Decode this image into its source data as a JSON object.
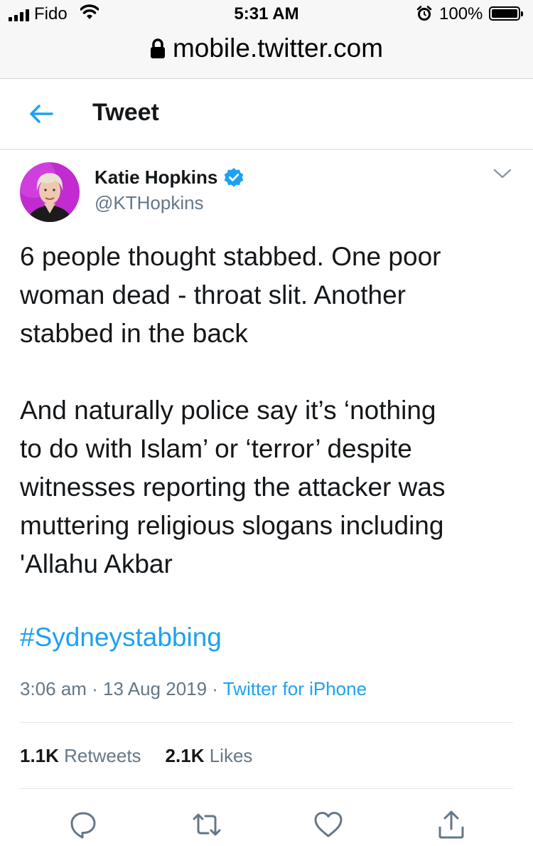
{
  "status_bar": {
    "carrier": "Fido",
    "time": "5:31 AM",
    "battery_percent": "100%",
    "battery_level": 1.0,
    "icons": [
      "signal-icon",
      "wifi-icon",
      "alarm-icon",
      "battery-icon"
    ]
  },
  "browser": {
    "url": "mobile.twitter.com",
    "lock_icon": "lock-icon"
  },
  "header": {
    "back_icon": "back-arrow-icon",
    "title": "Tweet"
  },
  "tweet": {
    "author_name": "Katie Hopkins",
    "verified_icon": "verified-badge-icon",
    "handle": "@KTHopkins",
    "menu_icon": "chevron-down-icon",
    "text_lines_1": [
      "6 people thought stabbed. One poor",
      "woman dead - throat slit. Another",
      "stabbed in the back"
    ],
    "text_lines_2": [
      "And naturally police say it’s ‘nothing",
      "to do with Islam’ or ‘terror’ despite",
      "witnesses reporting the attacker was",
      "muttering religious slogans including",
      "'Allahu Akbar"
    ],
    "hashtag": "#Sydneystabbing",
    "timestamp": "3:06 am · 13 Aug 2019 · ",
    "source": "Twitter for iPhone",
    "retweets_count": "1.1K",
    "retweets_label": "Retweets",
    "likes_count": "2.1K",
    "likes_label": "Likes"
  },
  "actions": [
    "reply-icon",
    "retweet-icon",
    "like-icon",
    "share-icon"
  ],
  "colors": {
    "accent": "#1da1f2",
    "text": "#14171a",
    "secondary": "#657786",
    "divider": "#e1e8ed",
    "browser_bar": "#f7f7f7"
  }
}
